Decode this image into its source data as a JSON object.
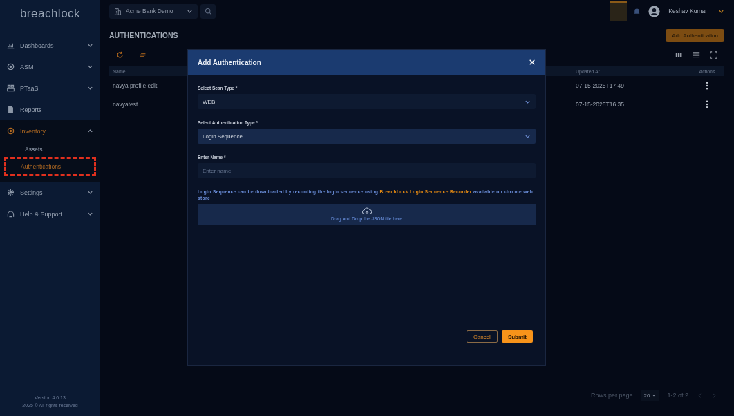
{
  "sidebar": {
    "logo": "breachlock",
    "items": [
      {
        "label": "Dashboards",
        "expanded": false,
        "selected": false
      },
      {
        "label": "ASM",
        "expanded": false,
        "selected": false
      },
      {
        "label": "PTaaS",
        "expanded": false,
        "selected": false
      },
      {
        "label": "Reports",
        "selected": false
      },
      {
        "label": "Inventory",
        "expanded": true,
        "selected": true,
        "children": [
          {
            "label": "Assets",
            "selected": false,
            "highlighted": false
          },
          {
            "label": "Authentications",
            "selected": true,
            "highlighted": true
          }
        ]
      },
      {
        "label": "Settings",
        "expanded": false,
        "selected": false
      },
      {
        "label": "Help & Support",
        "expanded": false,
        "selected": false
      }
    ],
    "version": "Version 4.0.13",
    "copyright": "2025 © All rights reserved"
  },
  "topbar": {
    "org": "Acme Bank Demo",
    "user": "Keshav Kumar"
  },
  "page": {
    "title": "AUTHENTICATIONS",
    "add_button": "Add Authentication"
  },
  "table": {
    "columns": [
      {
        "label": "Name",
        "kind": "name"
      },
      {
        "label": "Updated At",
        "kind": "date"
      },
      {
        "label": "Actions",
        "kind": "actions"
      }
    ],
    "rows": [
      {
        "name": "navya profile edit",
        "updated": "07-15-2025T17:49"
      },
      {
        "name": "navyatest",
        "updated": "07-15-2025T16:35"
      }
    ]
  },
  "pagination": {
    "label": "Rows per page",
    "rows": "20",
    "range": "1-2 of 2"
  },
  "modal": {
    "title": "Add Authentication",
    "fields": [
      {
        "kind": "select",
        "label": "Select Scan Type *",
        "value": "WEB",
        "focused": false
      },
      {
        "kind": "select",
        "label": "Select Authentication Type *",
        "value": "Login Sequence",
        "focused": true
      },
      {
        "kind": "text",
        "label": "Enter Name *",
        "placeholder": "Enter name"
      }
    ],
    "note": {
      "before": "Login Sequence can be downloaded by recording the login sequence using",
      "link": "BreachLock Login Sequence Recorder",
      "after": "available on chrome web store"
    },
    "dropzone": "Drag and Drop the JSON file here",
    "cancel": "Cancel",
    "submit": "Submit"
  }
}
